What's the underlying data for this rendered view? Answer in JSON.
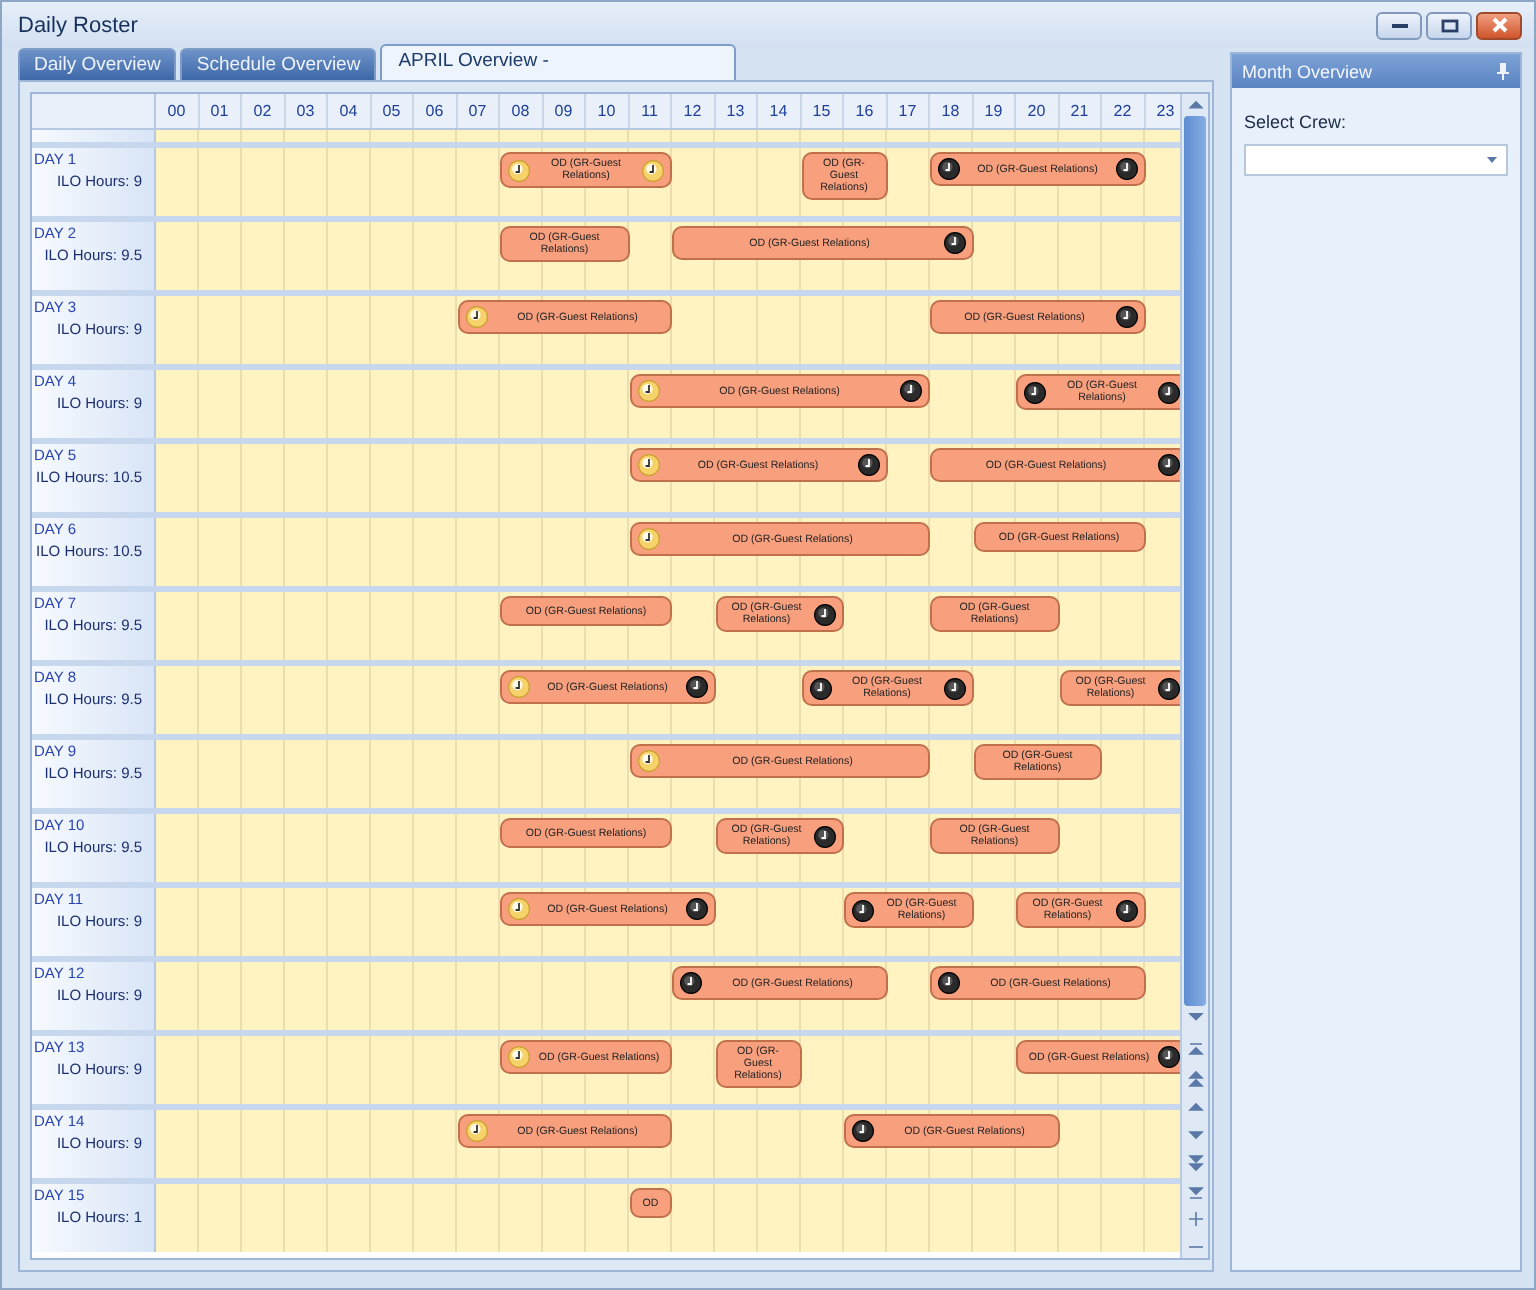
{
  "window": {
    "title": "Daily Roster"
  },
  "tabs": [
    {
      "label": "Daily Overview",
      "selected": false
    },
    {
      "label": "Schedule Overview",
      "selected": false
    },
    {
      "label": "APRIL Overview -",
      "selected": true
    }
  ],
  "roster": {
    "hours": [
      "00",
      "01",
      "02",
      "03",
      "04",
      "05",
      "06",
      "07",
      "08",
      "09",
      "10",
      "11",
      "12",
      "13",
      "14",
      "15",
      "16",
      "17",
      "18",
      "19",
      "20",
      "21",
      "22",
      "23"
    ],
    "days": [
      {
        "day": "DAY 1",
        "ilo": "ILO Hours: 9",
        "timeline": [
          {
            "kind": "gap"
          },
          {
            "kind": "gap"
          },
          {
            "kind": "gap"
          },
          {
            "kind": "gap"
          },
          {
            "kind": "gap"
          },
          {
            "kind": "gap"
          },
          {
            "kind": "gap"
          },
          {
            "kind": "gap"
          },
          {
            "kind": "shift",
            "label": "OD (GR-Guest Relations)",
            "start_clock": {
              "kind": "light"
            },
            "end_clock": {
              "kind": "light"
            }
          },
          {
            "kind": "more"
          },
          {
            "kind": "more"
          },
          {
            "kind": "more"
          },
          {
            "kind": "gap"
          },
          {
            "kind": "gap"
          },
          {
            "kind": "gap"
          },
          {
            "kind": "shift",
            "label": "OD (GR-Guest Relations)"
          },
          {
            "kind": "more"
          },
          {
            "kind": "gap"
          },
          {
            "kind": "shift",
            "label": "OD (GR-Guest Relations)",
            "start_clock": {
              "kind": "dark"
            },
            "end_clock": {
              "kind": "dark"
            }
          },
          {
            "kind": "more"
          },
          {
            "kind": "more"
          },
          {
            "kind": "more"
          },
          {
            "kind": "more"
          }
        ]
      },
      {
        "day": "DAY 2",
        "ilo": "ILO Hours: 9.5",
        "timeline": [
          {
            "kind": "gap"
          },
          {
            "kind": "gap"
          },
          {
            "kind": "gap"
          },
          {
            "kind": "gap"
          },
          {
            "kind": "gap"
          },
          {
            "kind": "gap"
          },
          {
            "kind": "gap"
          },
          {
            "kind": "gap"
          },
          {
            "kind": "shift",
            "label": "OD (GR-Guest Relations)"
          },
          {
            "kind": "more"
          },
          {
            "kind": "more"
          },
          {
            "kind": "gap"
          },
          {
            "kind": "shift",
            "label": "OD (GR-Guest Relations)",
            "end_clock": {
              "kind": "dark"
            }
          },
          {
            "kind": "more"
          },
          {
            "kind": "more"
          },
          {
            "kind": "more"
          },
          {
            "kind": "more"
          },
          {
            "kind": "more"
          },
          {
            "kind": "more"
          }
        ]
      },
      {
        "day": "DAY 3",
        "ilo": "ILO Hours: 9",
        "timeline": [
          {
            "kind": "gap"
          },
          {
            "kind": "gap"
          },
          {
            "kind": "gap"
          },
          {
            "kind": "gap"
          },
          {
            "kind": "gap"
          },
          {
            "kind": "gap"
          },
          {
            "kind": "gap"
          },
          {
            "kind": "shift",
            "label": "OD (GR-Guest Relations)",
            "start_clock": {
              "kind": "light"
            }
          },
          {
            "kind": "more"
          },
          {
            "kind": "more"
          },
          {
            "kind": "more"
          },
          {
            "kind": "more"
          },
          {
            "kind": "gap"
          },
          {
            "kind": "gap"
          },
          {
            "kind": "gap"
          },
          {
            "kind": "gap"
          },
          {
            "kind": "gap"
          },
          {
            "kind": "gap"
          },
          {
            "kind": "shift",
            "label": "OD (GR-Guest Relations)",
            "end_clock": {
              "kind": "dark"
            }
          },
          {
            "kind": "more"
          },
          {
            "kind": "more"
          },
          {
            "kind": "more"
          },
          {
            "kind": "more"
          }
        ]
      },
      {
        "day": "DAY 4",
        "ilo": "ILO Hours: 9",
        "timeline": [
          {
            "kind": "gap"
          },
          {
            "kind": "gap"
          },
          {
            "kind": "gap"
          },
          {
            "kind": "gap"
          },
          {
            "kind": "gap"
          },
          {
            "kind": "gap"
          },
          {
            "kind": "gap"
          },
          {
            "kind": "gap"
          },
          {
            "kind": "gap"
          },
          {
            "kind": "gap"
          },
          {
            "kind": "gap"
          },
          {
            "kind": "shift",
            "label": "OD (GR-Guest Relations)",
            "start_clock": {
              "kind": "light"
            },
            "end_clock": {
              "kind": "dark"
            }
          },
          {
            "kind": "more"
          },
          {
            "kind": "more"
          },
          {
            "kind": "more"
          },
          {
            "kind": "more"
          },
          {
            "kind": "more"
          },
          {
            "kind": "more"
          },
          {
            "kind": "gap"
          },
          {
            "kind": "gap"
          },
          {
            "kind": "shift",
            "label": "OD (GR-Guest Relations)",
            "start_clock": {
              "kind": "dark"
            },
            "end_clock": {
              "kind": "dark"
            }
          },
          {
            "kind": "more"
          },
          {
            "kind": "more"
          },
          {
            "kind": "more"
          }
        ]
      },
      {
        "day": "DAY 5",
        "ilo": "ILO Hours: 10.5",
        "timeline": [
          {
            "kind": "gap"
          },
          {
            "kind": "gap"
          },
          {
            "kind": "gap"
          },
          {
            "kind": "gap"
          },
          {
            "kind": "gap"
          },
          {
            "kind": "gap"
          },
          {
            "kind": "gap"
          },
          {
            "kind": "gap"
          },
          {
            "kind": "gap"
          },
          {
            "kind": "gap"
          },
          {
            "kind": "gap"
          },
          {
            "kind": "shift",
            "label": "OD (GR-Guest Relations)",
            "start_clock": {
              "kind": "light"
            },
            "end_clock": {
              "kind": "dark"
            }
          },
          {
            "kind": "more"
          },
          {
            "kind": "more"
          },
          {
            "kind": "more"
          },
          {
            "kind": "more"
          },
          {
            "kind": "more"
          },
          {
            "kind": "gap"
          },
          {
            "kind": "shift",
            "label": "OD (GR-Guest Relations)",
            "end_clock": {
              "kind": "dark"
            }
          },
          {
            "kind": "more"
          },
          {
            "kind": "more"
          },
          {
            "kind": "more"
          },
          {
            "kind": "more"
          },
          {
            "kind": "more"
          }
        ]
      },
      {
        "day": "DAY 6",
        "ilo": "ILO Hours: 10.5",
        "timeline": [
          {
            "kind": "gap"
          },
          {
            "kind": "gap"
          },
          {
            "kind": "gap"
          },
          {
            "kind": "gap"
          },
          {
            "kind": "gap"
          },
          {
            "kind": "gap"
          },
          {
            "kind": "gap"
          },
          {
            "kind": "gap"
          },
          {
            "kind": "gap"
          },
          {
            "kind": "gap"
          },
          {
            "kind": "gap"
          },
          {
            "kind": "shift",
            "label": "OD (GR-Guest Relations)",
            "start_clock": {
              "kind": "light"
            }
          },
          {
            "kind": "more"
          },
          {
            "kind": "more"
          },
          {
            "kind": "more"
          },
          {
            "kind": "more"
          },
          {
            "kind": "more"
          },
          {
            "kind": "more"
          },
          {
            "kind": "gap"
          },
          {
            "kind": "shift",
            "label": "OD (GR-Guest Relations)"
          },
          {
            "kind": "more"
          },
          {
            "kind": "more"
          },
          {
            "kind": "more"
          }
        ]
      },
      {
        "day": "DAY 7",
        "ilo": "ILO Hours: 9.5",
        "timeline": [
          {
            "kind": "gap"
          },
          {
            "kind": "gap"
          },
          {
            "kind": "gap"
          },
          {
            "kind": "gap"
          },
          {
            "kind": "gap"
          },
          {
            "kind": "gap"
          },
          {
            "kind": "gap"
          },
          {
            "kind": "gap"
          },
          {
            "kind": "shift",
            "label": "OD (GR-Guest Relations)"
          },
          {
            "kind": "more"
          },
          {
            "kind": "more"
          },
          {
            "kind": "more"
          },
          {
            "kind": "gap"
          },
          {
            "kind": "shift",
            "label": "OD (GR-Guest Relations)",
            "end_clock": {
              "kind": "dark"
            }
          },
          {
            "kind": "more"
          },
          {
            "kind": "more"
          },
          {
            "kind": "gap"
          },
          {
            "kind": "gap"
          },
          {
            "kind": "shift",
            "label": "OD (GR-Guest Relations)"
          },
          {
            "kind": "more"
          },
          {
            "kind": "more"
          }
        ]
      },
      {
        "day": "DAY 8",
        "ilo": "ILO Hours: 9.5",
        "timeline": [
          {
            "kind": "gap"
          },
          {
            "kind": "gap"
          },
          {
            "kind": "gap"
          },
          {
            "kind": "gap"
          },
          {
            "kind": "gap"
          },
          {
            "kind": "gap"
          },
          {
            "kind": "gap"
          },
          {
            "kind": "gap"
          },
          {
            "kind": "shift",
            "label": "OD (GR-Guest Relations)",
            "start_clock": {
              "kind": "light"
            },
            "end_clock": {
              "kind": "dark"
            }
          },
          {
            "kind": "more"
          },
          {
            "kind": "more"
          },
          {
            "kind": "more"
          },
          {
            "kind": "more"
          },
          {
            "kind": "gap"
          },
          {
            "kind": "gap"
          },
          {
            "kind": "shift",
            "label": "OD (GR-Guest Relations)",
            "start_clock": {
              "kind": "dark"
            },
            "end_clock": {
              "kind": "dark"
            }
          },
          {
            "kind": "more"
          },
          {
            "kind": "more"
          },
          {
            "kind": "more"
          },
          {
            "kind": "gap"
          },
          {
            "kind": "gap"
          },
          {
            "kind": "shift",
            "label": "OD (GR-Guest Relations)",
            "end_clock": {
              "kind": "dark"
            }
          },
          {
            "kind": "more"
          },
          {
            "kind": "more"
          }
        ]
      },
      {
        "day": "DAY 9",
        "ilo": "ILO Hours: 9.5",
        "timeline": [
          {
            "kind": "gap"
          },
          {
            "kind": "gap"
          },
          {
            "kind": "gap"
          },
          {
            "kind": "gap"
          },
          {
            "kind": "gap"
          },
          {
            "kind": "gap"
          },
          {
            "kind": "gap"
          },
          {
            "kind": "gap"
          },
          {
            "kind": "gap"
          },
          {
            "kind": "gap"
          },
          {
            "kind": "gap"
          },
          {
            "kind": "shift",
            "label": "OD (GR-Guest Relations)",
            "start_clock": {
              "kind": "light"
            }
          },
          {
            "kind": "more"
          },
          {
            "kind": "more"
          },
          {
            "kind": "more"
          },
          {
            "kind": "more"
          },
          {
            "kind": "more"
          },
          {
            "kind": "more"
          },
          {
            "kind": "gap"
          },
          {
            "kind": "shift",
            "label": "OD (GR-Guest Relations)"
          },
          {
            "kind": "more"
          },
          {
            "kind": "more"
          }
        ]
      },
      {
        "day": "DAY 10",
        "ilo": "ILO Hours: 9.5",
        "timeline": [
          {
            "kind": "gap"
          },
          {
            "kind": "gap"
          },
          {
            "kind": "gap"
          },
          {
            "kind": "gap"
          },
          {
            "kind": "gap"
          },
          {
            "kind": "gap"
          },
          {
            "kind": "gap"
          },
          {
            "kind": "gap"
          },
          {
            "kind": "shift",
            "label": "OD (GR-Guest Relations)"
          },
          {
            "kind": "more"
          },
          {
            "kind": "more"
          },
          {
            "kind": "more"
          },
          {
            "kind": "gap"
          },
          {
            "kind": "shift",
            "label": "OD (GR-Guest Relations)",
            "end_clock": {
              "kind": "dark"
            }
          },
          {
            "kind": "more"
          },
          {
            "kind": "more"
          },
          {
            "kind": "gap"
          },
          {
            "kind": "gap"
          },
          {
            "kind": "shift",
            "label": "OD (GR-Guest Relations)"
          },
          {
            "kind": "more"
          },
          {
            "kind": "more"
          }
        ]
      },
      {
        "day": "DAY 11",
        "ilo": "ILO Hours: 9",
        "timeline": [
          {
            "kind": "gap"
          },
          {
            "kind": "gap"
          },
          {
            "kind": "gap"
          },
          {
            "kind": "gap"
          },
          {
            "kind": "gap"
          },
          {
            "kind": "gap"
          },
          {
            "kind": "gap"
          },
          {
            "kind": "gap"
          },
          {
            "kind": "shift",
            "label": "OD (GR-Guest Relations)",
            "start_clock": {
              "kind": "light"
            },
            "end_clock": {
              "kind": "dark"
            }
          },
          {
            "kind": "more"
          },
          {
            "kind": "more"
          },
          {
            "kind": "more"
          },
          {
            "kind": "more"
          },
          {
            "kind": "gap"
          },
          {
            "kind": "gap"
          },
          {
            "kind": "gap"
          },
          {
            "kind": "shift",
            "label": "OD (GR-Guest Relations)",
            "start_clock": {
              "kind": "dark"
            }
          },
          {
            "kind": "more"
          },
          {
            "kind": "more"
          },
          {
            "kind": "gap"
          },
          {
            "kind": "shift",
            "label": "OD (GR-Guest Relations)",
            "end_clock": {
              "kind": "dark"
            }
          },
          {
            "kind": "more"
          },
          {
            "kind": "more"
          }
        ]
      },
      {
        "day": "DAY 12",
        "ilo": "ILO Hours: 9",
        "timeline": [
          {
            "kind": "gap"
          },
          {
            "kind": "gap"
          },
          {
            "kind": "gap"
          },
          {
            "kind": "gap"
          },
          {
            "kind": "gap"
          },
          {
            "kind": "gap"
          },
          {
            "kind": "gap"
          },
          {
            "kind": "gap"
          },
          {
            "kind": "gap"
          },
          {
            "kind": "gap"
          },
          {
            "kind": "gap"
          },
          {
            "kind": "gap"
          },
          {
            "kind": "shift",
            "label": "OD (GR-Guest Relations)",
            "start_clock": {
              "kind": "dark"
            }
          },
          {
            "kind": "more"
          },
          {
            "kind": "more"
          },
          {
            "kind": "more"
          },
          {
            "kind": "more"
          },
          {
            "kind": "gap"
          },
          {
            "kind": "shift",
            "label": "OD (GR-Guest Relations)",
            "start_clock": {
              "kind": "dark"
            }
          },
          {
            "kind": "more"
          },
          {
            "kind": "more"
          },
          {
            "kind": "more"
          },
          {
            "kind": "more"
          }
        ]
      },
      {
        "day": "DAY 13",
        "ilo": "ILO Hours: 9",
        "timeline": [
          {
            "kind": "gap"
          },
          {
            "kind": "gap"
          },
          {
            "kind": "gap"
          },
          {
            "kind": "gap"
          },
          {
            "kind": "gap"
          },
          {
            "kind": "gap"
          },
          {
            "kind": "gap"
          },
          {
            "kind": "gap"
          },
          {
            "kind": "shift",
            "label": "OD (GR-Guest Relations)",
            "start_clock": {
              "kind": "light"
            }
          },
          {
            "kind": "more"
          },
          {
            "kind": "more"
          },
          {
            "kind": "more"
          },
          {
            "kind": "gap"
          },
          {
            "kind": "shift",
            "label": "OD (GR-Guest Relations)"
          },
          {
            "kind": "more"
          },
          {
            "kind": "gap"
          },
          {
            "kind": "gap"
          },
          {
            "kind": "gap"
          },
          {
            "kind": "gap"
          },
          {
            "kind": "gap"
          },
          {
            "kind": "shift",
            "label": "OD (GR-Guest Relations)",
            "end_clock": {
              "kind": "dark"
            }
          },
          {
            "kind": "more"
          },
          {
            "kind": "more"
          },
          {
            "kind": "more"
          }
        ]
      },
      {
        "day": "DAY 14",
        "ilo": "ILO Hours: 9",
        "timeline": [
          {
            "kind": "gap"
          },
          {
            "kind": "gap"
          },
          {
            "kind": "gap"
          },
          {
            "kind": "gap"
          },
          {
            "kind": "gap"
          },
          {
            "kind": "gap"
          },
          {
            "kind": "gap"
          },
          {
            "kind": "shift",
            "label": "OD (GR-Guest Relations)",
            "start_clock": {
              "kind": "light"
            }
          },
          {
            "kind": "more"
          },
          {
            "kind": "more"
          },
          {
            "kind": "more"
          },
          {
            "kind": "more"
          },
          {
            "kind": "gap"
          },
          {
            "kind": "gap"
          },
          {
            "kind": "gap"
          },
          {
            "kind": "gap"
          },
          {
            "kind": "shift",
            "label": "OD (GR-Guest Relations)",
            "start_clock": {
              "kind": "dark"
            }
          },
          {
            "kind": "more"
          },
          {
            "kind": "more"
          },
          {
            "kind": "more"
          },
          {
            "kind": "more"
          }
        ]
      },
      {
        "day": "DAY 15",
        "ilo": "ILO Hours: 1",
        "timeline": [
          {
            "kind": "gap"
          },
          {
            "kind": "gap"
          },
          {
            "kind": "gap"
          },
          {
            "kind": "gap"
          },
          {
            "kind": "gap"
          },
          {
            "kind": "gap"
          },
          {
            "kind": "gap"
          },
          {
            "kind": "gap"
          },
          {
            "kind": "gap"
          },
          {
            "kind": "gap"
          },
          {
            "kind": "gap"
          },
          {
            "kind": "shift",
            "label": "OD"
          }
        ]
      }
    ]
  },
  "month_panel": {
    "title": "Month Overview",
    "crew_label": "Select Crew:"
  }
}
